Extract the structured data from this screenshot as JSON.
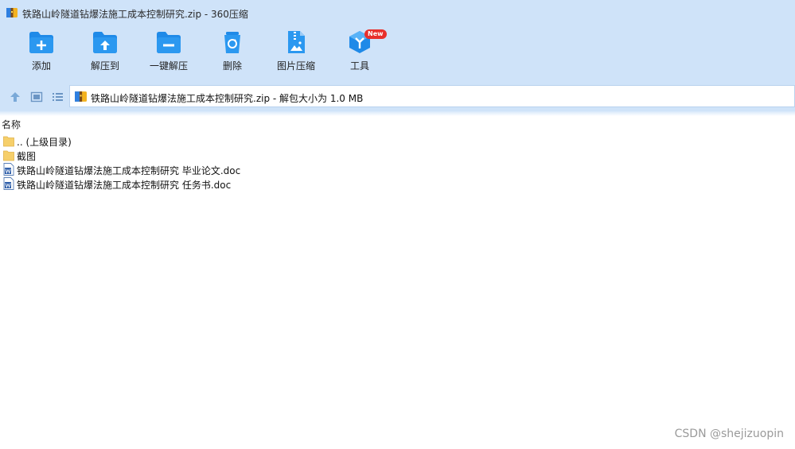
{
  "window": {
    "title": "铁路山岭隧道钻爆法施工成本控制研究.zip - 360压缩"
  },
  "toolbar": {
    "items": [
      {
        "label": "添加",
        "icon": "add-folder-icon"
      },
      {
        "label": "解压到",
        "icon": "extract-to-icon"
      },
      {
        "label": "一键解压",
        "icon": "one-click-extract-icon"
      },
      {
        "label": "删除",
        "icon": "recycle-bin-icon"
      },
      {
        "label": "图片压缩",
        "icon": "image-compress-icon"
      },
      {
        "label": "工具",
        "icon": "tools-cube-icon",
        "badge": "New"
      }
    ]
  },
  "navbar": {
    "icons": [
      "up-arrow-icon",
      "thumbnail-view-icon",
      "list-view-icon"
    ],
    "address": "铁路山岭隧道钻爆法施工成本控制研究.zip - 解包大小为 1.0 MB"
  },
  "file_list": {
    "column_header": "名称",
    "rows": [
      {
        "name": ".. (上级目录)",
        "type": "folder"
      },
      {
        "name": "截图",
        "type": "folder"
      },
      {
        "name": "铁路山岭隧道钻爆法施工成本控制研究 毕业论文.doc",
        "type": "word"
      },
      {
        "name": "铁路山岭隧道钻爆法施工成本控制研究 任务书.doc",
        "type": "word"
      }
    ]
  },
  "watermark": "CSDN @shejizuopin",
  "colors": {
    "chrome_bg": "#cfe3f9",
    "icon_blue": "#1f8ae8",
    "badge_red": "#e8302c"
  }
}
